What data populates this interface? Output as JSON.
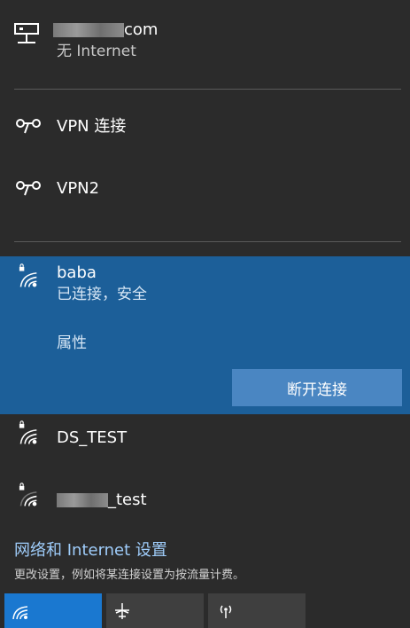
{
  "networks": {
    "wired": {
      "name_suffix": "com",
      "status": "无 Internet"
    },
    "vpn1": {
      "name": "VPN 连接"
    },
    "vpn2": {
      "name": "VPN2"
    },
    "connected": {
      "name": "baba",
      "status": "已连接，安全",
      "properties": "属性",
      "disconnect": "断开连接"
    },
    "ds_test": {
      "name": "DS_TEST"
    },
    "other": {
      "name_suffix": "_test"
    }
  },
  "settings": {
    "link": "网络和 Internet 设置",
    "description": "更改设置，例如将某连接设置为按流量计费。"
  },
  "quick_actions": {
    "active_color": "#1a78d0",
    "icons": [
      "wifi-icon",
      "airplane-icon",
      "hotspot-icon"
    ]
  }
}
